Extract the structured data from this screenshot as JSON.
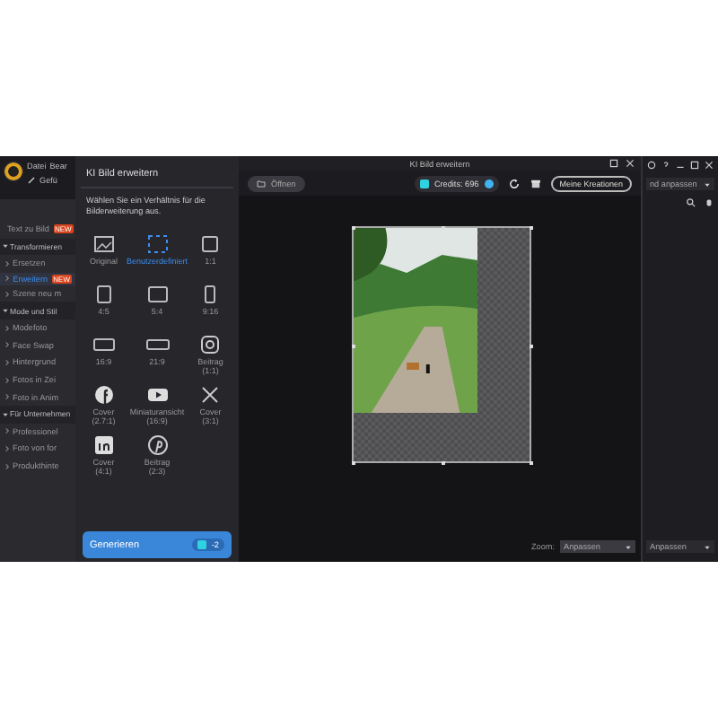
{
  "app": {
    "menu": [
      "Datei",
      "Bear"
    ],
    "tool_label": "Gefü"
  },
  "sidebar": {
    "items": [
      {
        "kind": "link",
        "label": "Text zu Bild",
        "badge": "NEW",
        "selected": false
      },
      {
        "kind": "section",
        "label": "Transformieren",
        "expanded": true,
        "children": [
          {
            "label": "Ersetzen",
            "selected": false
          },
          {
            "label": "Erweitern",
            "badge": "NEW",
            "selected": true
          },
          {
            "label": "Szene neu m",
            "selected": false
          }
        ]
      },
      {
        "kind": "section",
        "label": "Mode und Stil",
        "expanded": true,
        "children": [
          {
            "label": "Modefoto",
            "selected": false
          },
          {
            "label": "Face Swap",
            "selected": false
          },
          {
            "label": "Hintergrund",
            "selected": false
          },
          {
            "label": "Fotos in Zei",
            "selected": false
          },
          {
            "label": "Foto in Anim",
            "selected": false
          }
        ]
      },
      {
        "kind": "section",
        "label": "Für Unternehmen",
        "expanded": true,
        "children": [
          {
            "label": "Professionel",
            "selected": false
          },
          {
            "label": "Foto von for",
            "selected": false
          },
          {
            "label": "Produkthinte",
            "selected": false
          }
        ]
      }
    ]
  },
  "dialog": {
    "title": "KI Bild erweitern",
    "description": "Wählen Sie ein Verhältnis für die Bilderweiterung aus.",
    "ratios": [
      {
        "kind": "original",
        "label": "Original",
        "selected": false
      },
      {
        "kind": "custom",
        "label": "Benutzerdefiniert",
        "selected": true
      },
      {
        "kind": "square",
        "label": "1:1",
        "selected": false
      },
      {
        "kind": "portrait",
        "label": "4:5",
        "selected": false
      },
      {
        "kind": "landscape",
        "label": "5:4",
        "selected": false
      },
      {
        "kind": "tall",
        "label": "9:16",
        "selected": false
      },
      {
        "kind": "wide",
        "label": "16:9",
        "selected": false
      },
      {
        "kind": "ultrawide",
        "label": "21:9",
        "selected": false
      },
      {
        "kind": "instagram",
        "label": "Beitrag",
        "note": "(1:1)",
        "selected": false
      },
      {
        "kind": "facebook",
        "label": "Cover",
        "note": "(2.7:1)",
        "selected": false
      },
      {
        "kind": "youtube",
        "label": "Miniaturansicht",
        "note": "(16:9)",
        "selected": false
      },
      {
        "kind": "x",
        "label": "Cover",
        "note": "(3:1)",
        "selected": false
      },
      {
        "kind": "linkedin",
        "label": "Cover",
        "note": "(4:1)",
        "selected": false
      },
      {
        "kind": "pinterest",
        "label": "Beitrag",
        "note": "(2:3)",
        "selected": false
      }
    ],
    "generate": {
      "label": "Generieren",
      "cost": "-2"
    }
  },
  "editor": {
    "window_title": "KI Bild erweitern",
    "open_button": "Öffnen",
    "credits": "Credits: 696",
    "my_creations": "Meine Kreationen",
    "zoom_label": "Zoom:",
    "zoom_value": "Anpassen"
  },
  "right_panel": {
    "dropdown": "nd anpassen",
    "bottom_dropdown": "Anpassen"
  }
}
